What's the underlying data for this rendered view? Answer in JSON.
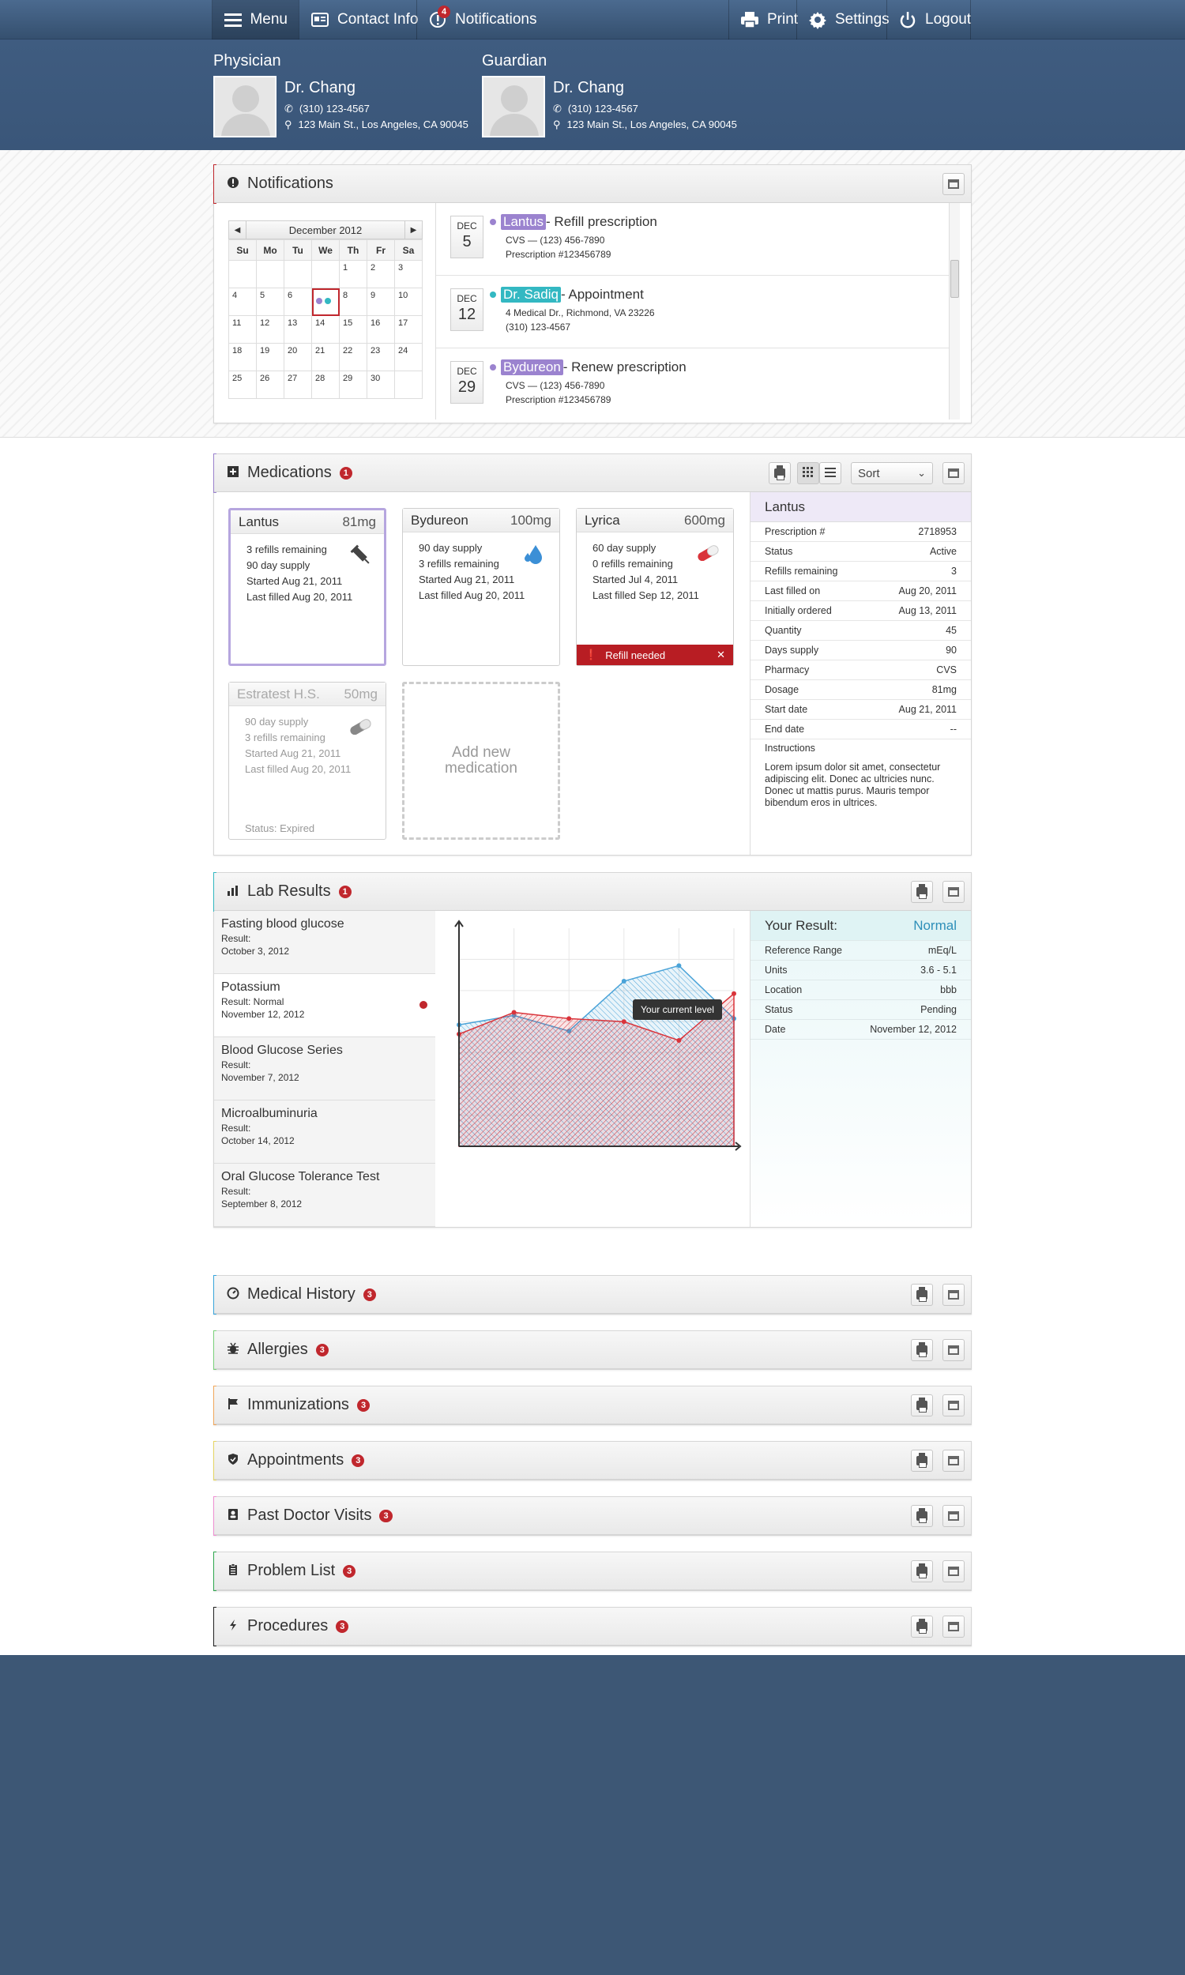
{
  "nav": {
    "menu": "Menu",
    "contact": "Contact Info",
    "notifications": "Notifications",
    "notifications_count": "4",
    "print": "Print",
    "settings": "Settings",
    "logout": "Logout"
  },
  "physician": {
    "heading": "Physician",
    "name": "Dr. Chang",
    "phone": "(310) 123-4567",
    "address": "123 Main St., Los Angeles, CA 90045"
  },
  "guardian": {
    "heading": "Guardian",
    "name": "Dr. Chang",
    "phone": "(310) 123-4567",
    "address": "123 Main St., Los Angeles, CA 90045"
  },
  "notifications": {
    "title": "Notifications",
    "calendar": {
      "month": "December 2012",
      "dow": [
        "Su",
        "Mo",
        "Tu",
        "We",
        "Th",
        "Fr",
        "Sa"
      ],
      "weeks": [
        [
          "",
          "",
          "",
          "",
          "1",
          "2",
          "3"
        ],
        [
          "4",
          "5",
          "6",
          "",
          "8",
          "9",
          "10"
        ],
        [
          "11",
          "12",
          "13",
          "14",
          "15",
          "16",
          "17"
        ],
        [
          "18",
          "19",
          "20",
          "21",
          "22",
          "23",
          "24"
        ],
        [
          "25",
          "26",
          "27",
          "28",
          "29",
          "30",
          ""
        ]
      ]
    },
    "items": [
      {
        "month": "DEC",
        "day": "5",
        "tag": "Lantus",
        "tag_color": "#9b83cf",
        "title": " - Refill prescription",
        "line1": "CVS  —  (123) 456-7890",
        "line2": "Prescription #123456789"
      },
      {
        "month": "DEC",
        "day": "12",
        "tag": "Dr. Sadiq",
        "tag_color": "#33b8c2",
        "title": " - Appointment",
        "line1": "4 Medical Dr., Richmond, VA 23226",
        "line2": "(310) 123-4567"
      },
      {
        "month": "DEC",
        "day": "29",
        "tag": "Bydureon",
        "tag_color": "#9b83cf",
        "title": " - Renew prescription",
        "line1": "CVS  —  (123) 456-7890",
        "line2": "Prescription #123456789"
      }
    ]
  },
  "medications": {
    "title": "Medications",
    "badge": "1",
    "sort": "Sort",
    "cards": [
      {
        "name": "Lantus",
        "dose": "81mg",
        "lines": [
          "3 refills remaining",
          "90 day supply",
          "Started Aug 21, 2011",
          "Last filled Aug 20, 2011"
        ],
        "icon": "syringe-icon"
      },
      {
        "name": "Bydureon",
        "dose": "100mg",
        "lines": [
          "90 day supply",
          "3 refills remaining",
          "Started Aug 21, 2011",
          "Last filled Aug 20, 2011"
        ],
        "icon": "drops-icon"
      },
      {
        "name": "Lyrica",
        "dose": "600mg",
        "lines": [
          "60 day supply",
          "0 refills remaining",
          "Started Jul 4, 2011",
          "Last filled Sep 12, 2011"
        ],
        "icon": "pill-icon",
        "alert": "Refill needed"
      },
      {
        "name": "Estratest H.S.",
        "dose": "50mg",
        "lines": [
          "90 day supply",
          "3 refills remaining",
          "Started Aug 21, 2011",
          "Last filled Aug 20, 2011"
        ],
        "icon": "pill-gray-icon",
        "status": "Status: Expired"
      }
    ],
    "add_new": "Add new medication",
    "detail": {
      "name": "Lantus",
      "rows": [
        [
          "Prescription #",
          "2718953"
        ],
        [
          "Status",
          "Active"
        ],
        [
          "Refills remaining",
          "3"
        ],
        [
          "Last filled on",
          "Aug 20, 2011"
        ],
        [
          "Initially ordered",
          "Aug 13, 2011"
        ],
        [
          "Quantity",
          "45"
        ],
        [
          "Days supply",
          "90"
        ],
        [
          "Pharmacy",
          "CVS"
        ],
        [
          "Dosage",
          "81mg"
        ],
        [
          "Start date",
          "Aug 21, 2011"
        ],
        [
          "End date",
          "--"
        ]
      ],
      "instructions_label": "Instructions",
      "instructions": "Lorem ipsum dolor sit amet, consectetur adipiscing elit. Donec ac ultricies nunc. Donec ut mattis purus. Mauris tempor bibendum eros in ultrices."
    }
  },
  "labs": {
    "title": "Lab Results",
    "badge": "1",
    "items": [
      {
        "name": "Fasting blood glucose",
        "result": "Result:",
        "date": "October 3, 2012"
      },
      {
        "name": "Potassium",
        "result": "Result: Normal",
        "date": "November 12, 2012"
      },
      {
        "name": "Blood Glucose Series",
        "result": "Result:",
        "date": "November 7, 2012"
      },
      {
        "name": "Microalbuminuria",
        "result": "Result:",
        "date": "October 14, 2012"
      },
      {
        "name": "Oral Glucose Tolerance Test",
        "result": "Result:",
        "date": "September 8, 2012"
      }
    ],
    "tooltip": "Your current level",
    "result_label": "Your Result:",
    "result_value": "Normal",
    "rows": [
      [
        "Reference Range",
        "mEq/L"
      ],
      [
        "Units",
        "3.6 - 5.1"
      ],
      [
        "Location",
        "bbb"
      ],
      [
        "Status",
        "Pending"
      ],
      [
        "Date",
        "November 12, 2012"
      ]
    ]
  },
  "chart_data": {
    "type": "area",
    "series": [
      {
        "color": "#4aa3d8",
        "values": [
          3.9,
          4.2,
          3.7,
          5.3,
          5.8,
          4.1
        ]
      },
      {
        "color": "#d9333a",
        "values": [
          3.6,
          4.3,
          4.1,
          4.0,
          3.4,
          4.9
        ]
      }
    ],
    "ylim": [
      0,
      7
    ]
  },
  "sections": [
    {
      "title": "Medical History",
      "badge": "3",
      "color": "#3aa6dd",
      "icon": "dashboard-icon"
    },
    {
      "title": "Allergies",
      "badge": "3",
      "color": "#7bd17a",
      "icon": "bug-icon"
    },
    {
      "title": "Immunizations",
      "badge": "3",
      "color": "#f2a85c",
      "icon": "flag-icon"
    },
    {
      "title": "Appointments",
      "badge": "3",
      "color": "#e6d563",
      "icon": "shield-icon"
    },
    {
      "title": "Past Doctor Visits",
      "badge": "3",
      "color": "#f08fd3",
      "icon": "contacts-icon"
    },
    {
      "title": "Problem List",
      "badge": "3",
      "color": "#2fa84f",
      "icon": "clipboard-icon"
    },
    {
      "title": "Procedures",
      "badge": "3",
      "color": "#222222",
      "icon": "bolt-icon"
    }
  ]
}
